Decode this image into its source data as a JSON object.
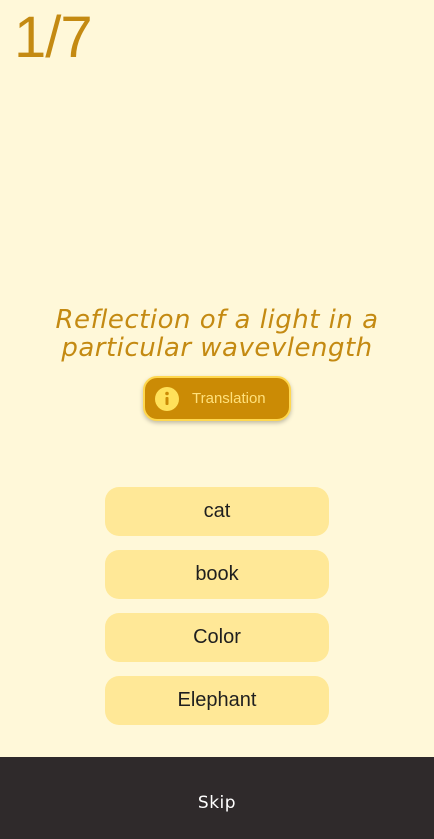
{
  "progress": {
    "counter_text": "1/7"
  },
  "question": {
    "line1": "Reflection of a light in a",
    "line2": "particular wavevlength"
  },
  "translation_button": {
    "label": "Translation",
    "icon": "info-icon"
  },
  "answers": [
    {
      "label": "cat"
    },
    {
      "label": "book"
    },
    {
      "label": "Color"
    },
    {
      "label": "Elephant"
    }
  ],
  "footer": {
    "skip_label": "Skip"
  },
  "colors": {
    "background": "#fff8d9",
    "accent": "#c48a12",
    "answer_bg": "#ffe897",
    "translation_bg": "#cb8b05",
    "footer_bg": "#2f2a2b"
  }
}
